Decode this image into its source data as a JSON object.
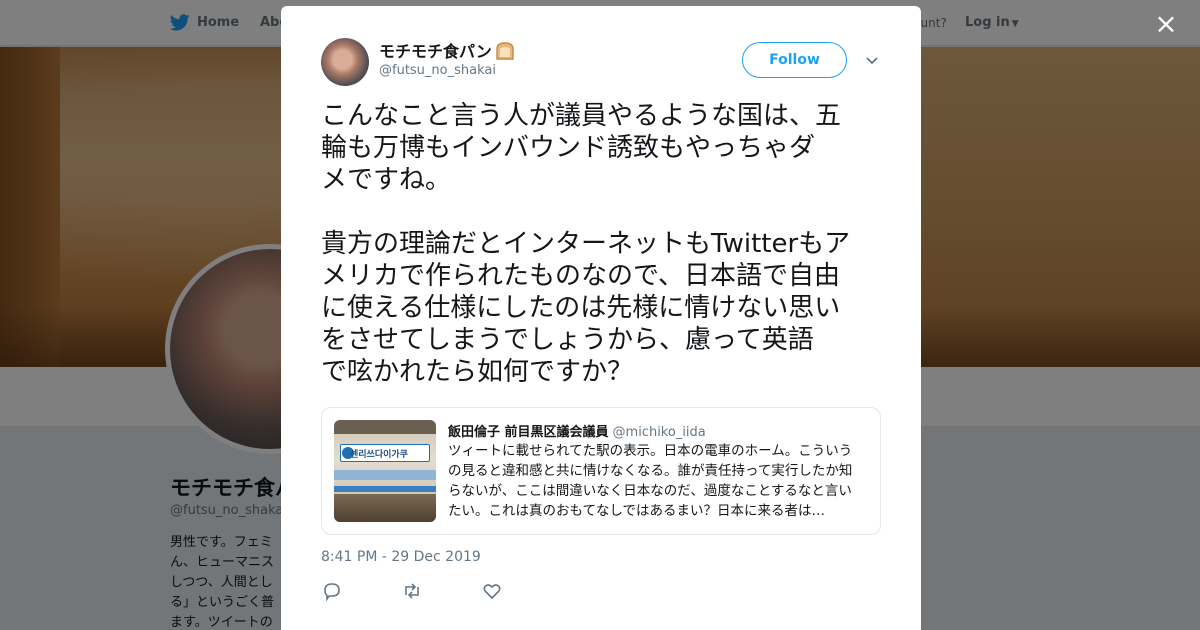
{
  "topbar": {
    "home_label": "Home",
    "about_label": "Abo",
    "have_account": "ccount?",
    "login_label": "Log in"
  },
  "profile": {
    "name": "モチモチ食パン🍞",
    "handle": "@futsu_no_shakai",
    "bio_lines": [
      "男性です。フェミ",
      "ん、ヒューマニス",
      "しつつ、人間とし",
      "る」というごく普",
      "ます。ツイートの"
    ]
  },
  "modal": {
    "close_label": "×",
    "author": {
      "name": "モチモチ食パン",
      "handle": "@futsu_no_shakai"
    },
    "follow_label": "Follow",
    "tweet_lines_1": [
      "こんなこと言う人が議員やるような国は、五",
      "輪も万博もインバウンド誘致もやっちゃダ",
      "メですね。"
    ],
    "tweet_lines_2": [
      "貴方の理論だとインターネットもTwitterもア",
      "メリカで作られたものなので、日本語で自由",
      "に使える仕様にしたのは先様に情けない思い",
      "をさせてしまうでしょうから、慮って英語",
      "で呟かれたら如何ですか？"
    ],
    "quote": {
      "author_name": "飯田倫子 前目黒区議会議員",
      "author_handle": "@michiko_iida",
      "thumb_sign": "센리쓰다이가쿠",
      "body_lines": [
        "ツィートに載せられてた駅の表示。日本の電車のホーム。こういう",
        "の見ると違和感と共に情けなくなる。誰が責任持って実行したか知",
        "らないが、ここは間違いなく日本なのだ、過度なことするなと言い",
        "たい。これは真のおもてなしではあるまい？日本に来る者は…"
      ]
    },
    "timestamp": "8:41 PM - 29 Dec 2019"
  },
  "colors": {
    "accent": "#1da1f2",
    "text": "#14171a",
    "muted": "#657786"
  },
  "icons": [
    "twitter-bird-icon",
    "caret-down-icon",
    "close-icon",
    "bread-emoji-icon",
    "reply-icon",
    "retweet-icon",
    "like-icon"
  ]
}
